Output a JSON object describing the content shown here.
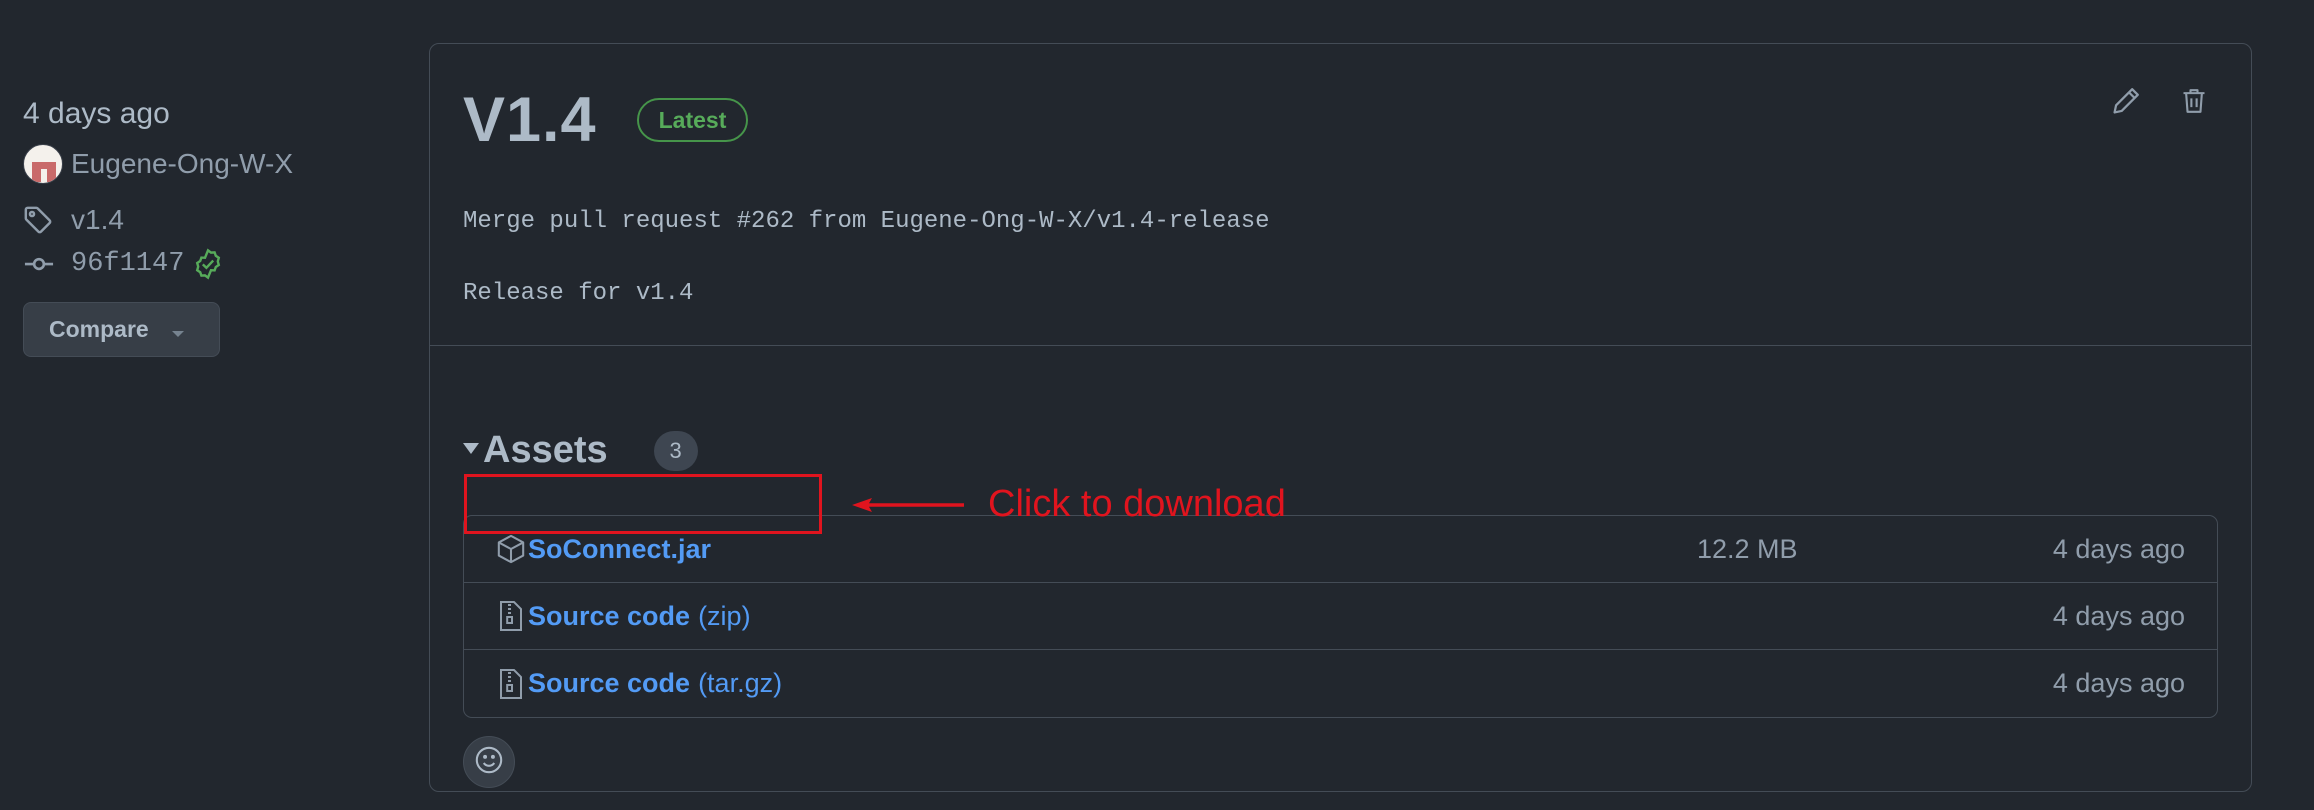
{
  "sidebar": {
    "date": "4 days ago",
    "author": "Eugene-Ong-W-X",
    "tag": "v1.4",
    "commit": "96f1147",
    "compare_label": "Compare"
  },
  "release": {
    "title": "V1.4",
    "badge": "Latest",
    "body_lines": [
      "Merge pull request #262 from Eugene-Ong-W-X/v1.4-release",
      "Release for v1.4"
    ]
  },
  "assets": {
    "title": "Assets",
    "count": "3",
    "items": [
      {
        "name": "SoConnect.jar",
        "ext": "",
        "size": "12.2 MB",
        "date": "4 days ago",
        "icon": "package-icon"
      },
      {
        "name": "Source code",
        "ext": "(zip)",
        "size": "",
        "date": "4 days ago",
        "icon": "file-zip-icon"
      },
      {
        "name": "Source code",
        "ext": "(tar.gz)",
        "size": "",
        "date": "4 days ago",
        "icon": "file-zip-icon"
      }
    ]
  },
  "annotation": {
    "text": "Click to download",
    "color": "#e0141e"
  },
  "colors": {
    "background": "#22272e",
    "link": "#539bf5",
    "success": "#57ab5a",
    "border": "#444c56"
  }
}
